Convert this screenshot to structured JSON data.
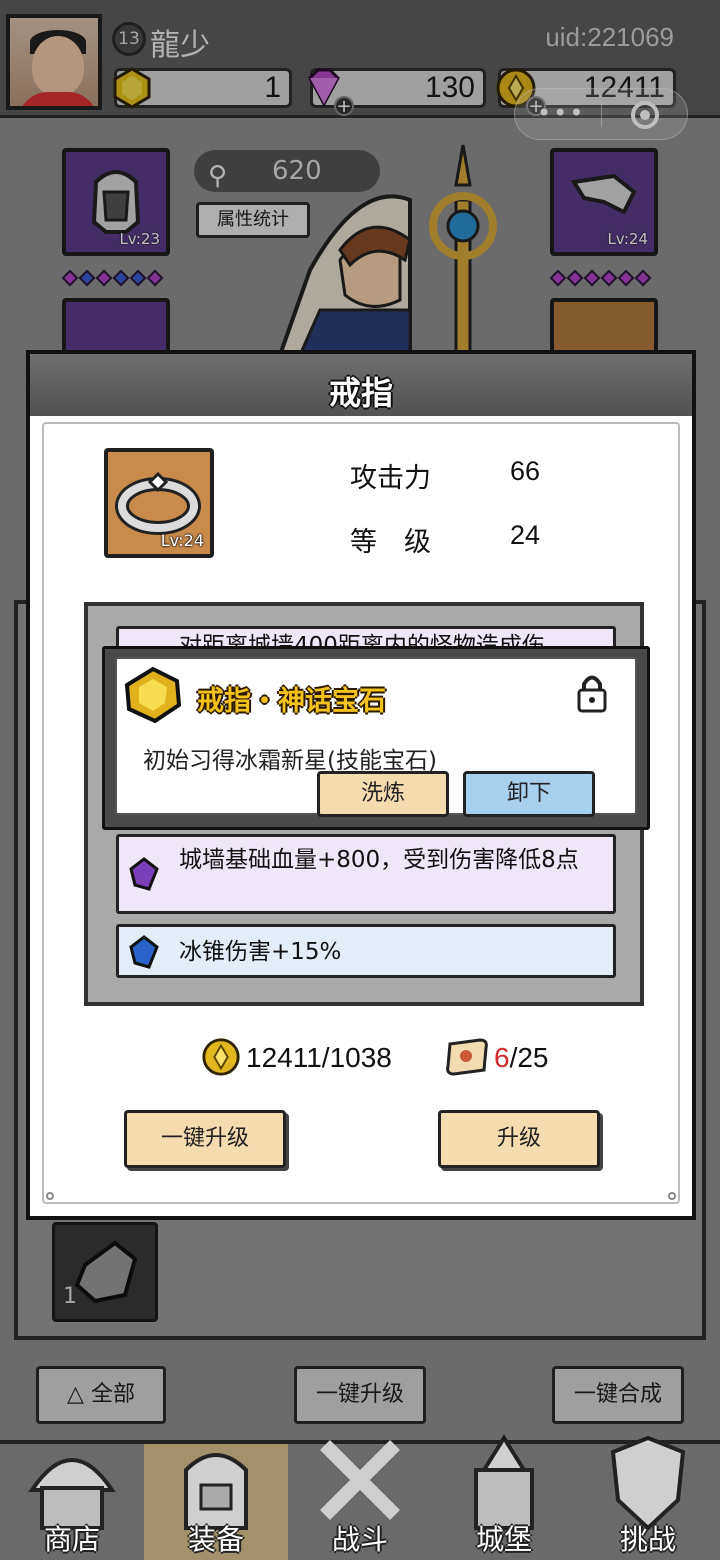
{
  "player": {
    "level": "13",
    "name": "龍少",
    "uid": "uid:221069"
  },
  "resources": {
    "gem": "1",
    "diamond": "130",
    "gold": "12411"
  },
  "equipment": {
    "power": "620",
    "stats_button": "属性统计",
    "slot_left_level": "Lv:23",
    "slot_right_level": "Lv:24"
  },
  "modal": {
    "title": "戒指",
    "item_level_badge": "Lv:24",
    "stats": [
      {
        "label": "攻击力",
        "value": "66"
      },
      {
        "label": "等　级",
        "value": "24"
      }
    ],
    "hidden_attr": "对距离城墙400距离内的怪物造成伤",
    "mythic": {
      "title": "戒指・神话宝石",
      "description": "初始习得冰霜新星(技能宝石)",
      "refine_label": "洗炼",
      "unequip_label": "卸下"
    },
    "attributes": [
      {
        "text": "城墙基础血量+800，受到伤害降低8点",
        "gem": "purple-gem-icon",
        "color": "#efe6f7"
      },
      {
        "text": "冰锥伤害+15%",
        "gem": "blue-gem-icon",
        "color": "#e3edf7"
      }
    ],
    "gold_cost": "12411/1038",
    "scroll_have": "6",
    "scroll_need": "/25",
    "one_key_upgrade": "一键升级",
    "upgrade": "升级"
  },
  "background_ui": {
    "material_count": "1",
    "filter_all": "全部",
    "filter_upgrade": "一键升级",
    "filter_merge": "一键合成"
  },
  "nav": {
    "tabs": [
      "商店",
      "装备",
      "战斗",
      "城堡",
      "挑战"
    ],
    "active": "装备"
  },
  "colors": {
    "accent_gold": "#f4c21d",
    "button_beige": "#f5dcaf",
    "button_blue": "#a7d0ee",
    "slot_purple": "#5b3d8a",
    "slot_orange": "#c98b4c",
    "red_count": "#d12b2b"
  }
}
